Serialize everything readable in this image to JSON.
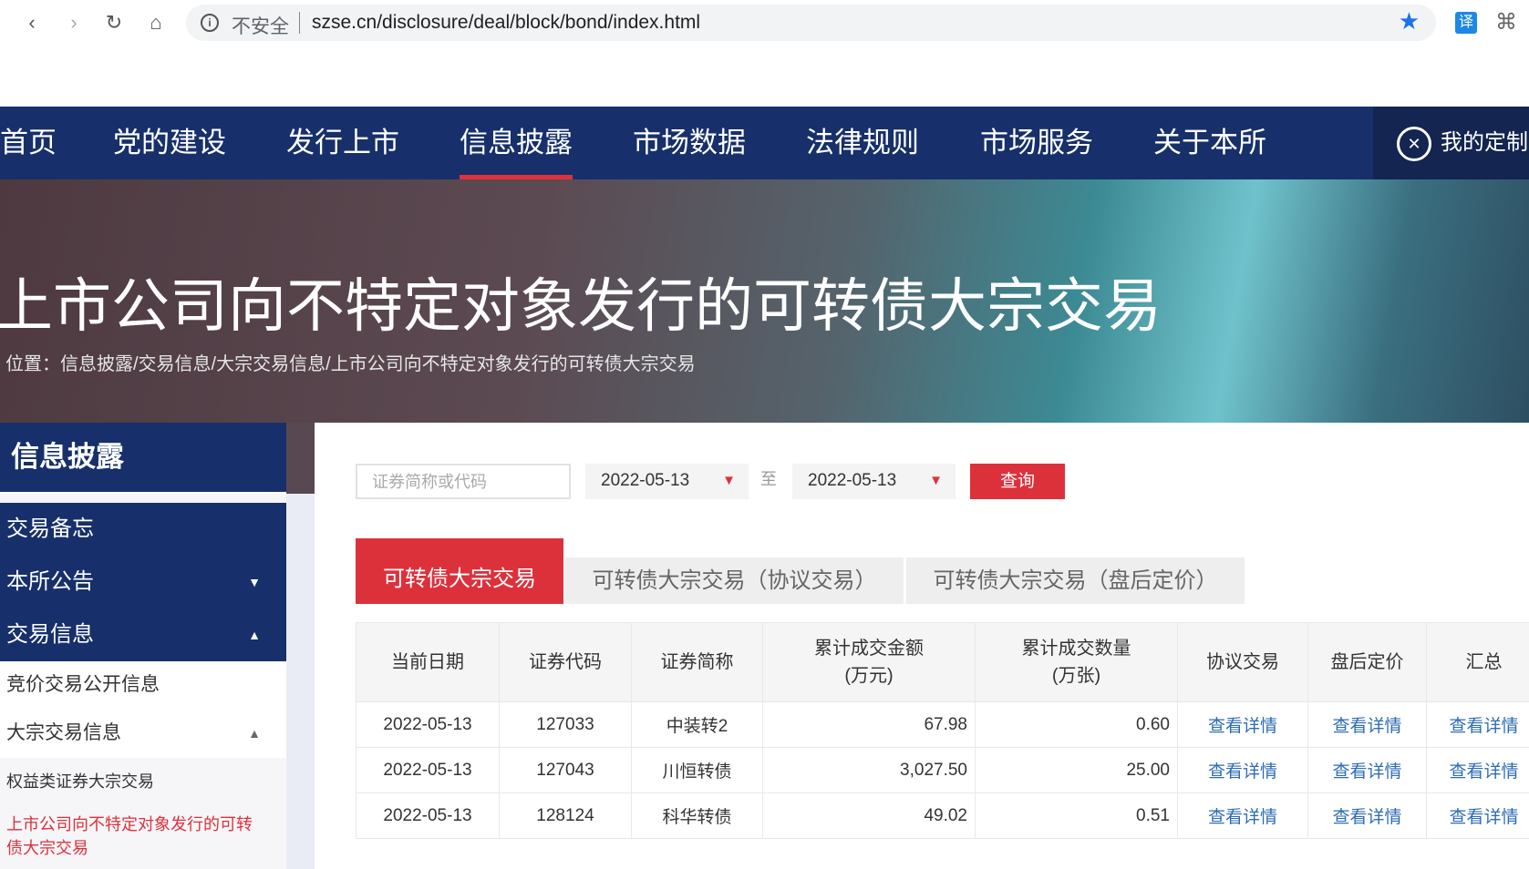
{
  "browser": {
    "insecure_label": "不安全",
    "url": "szse.cn/disclosure/deal/block/bond/index.html",
    "translate_label": "译"
  },
  "nav": {
    "items": [
      "首页",
      "党的建设",
      "发行上市",
      "信息披露",
      "市场数据",
      "法律规则",
      "市场服务",
      "关于本所"
    ],
    "active": 3,
    "custom_label": "我的定制"
  },
  "banner": {
    "title": "上市公司向不特定对象发行的可转债大宗交易",
    "breadcrumb": "位置：信息披露/交易信息/大宗交易信息/上市公司向不特定对象发行的可转债大宗交易"
  },
  "sidebar": {
    "title": "信息披露",
    "items": [
      {
        "label": "交易备忘"
      },
      {
        "label": "本所公告",
        "arrow": "▼"
      },
      {
        "label": "交易信息",
        "arrow": "▲"
      },
      {
        "label": "竞价交易公开信息"
      },
      {
        "label": "大宗交易信息",
        "arrow": "▲"
      },
      {
        "label": "权益类证券大宗交易"
      },
      {
        "label": "上市公司向不特定对象发行的可转债大宗交易"
      }
    ]
  },
  "filters": {
    "search_placeholder": "证券简称或代码",
    "start_date": "2022-05-13",
    "to_label": "至",
    "end_date": "2022-05-13",
    "query_label": "查询"
  },
  "tabs": [
    "可转债大宗交易",
    "可转债大宗交易（协议交易）",
    "可转债大宗交易（盘后定价）"
  ],
  "table": {
    "headers": [
      "当前日期",
      "证券代码",
      "证券简称",
      "累计成交金额\n(万元)",
      "累计成交数量\n(万张)",
      "协议交易",
      "盘后定价",
      "汇总"
    ],
    "rows": [
      [
        "2022-05-13",
        "127033",
        "中装转2",
        "67.98",
        "0.60",
        "查看详情",
        "查看详情",
        "查看详情"
      ],
      [
        "2022-05-13",
        "127043",
        "川恒转债",
        "3,027.50",
        "25.00",
        "查看详情",
        "查看详情",
        "查看详情"
      ],
      [
        "2022-05-13",
        "128124",
        "科华转债",
        "49.02",
        "0.51",
        "查看详情",
        "查看详情",
        "查看详情"
      ]
    ]
  },
  "colors": {
    "navy": "#17306b",
    "red": "#dc313b",
    "link": "#2d6cb5"
  }
}
